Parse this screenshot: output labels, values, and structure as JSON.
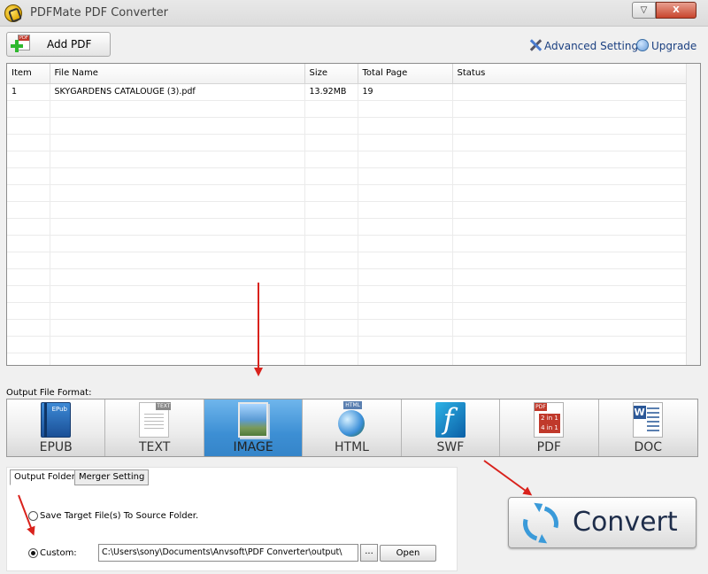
{
  "window": {
    "title": "PDFMate PDF Converter",
    "min_glyph": "▽",
    "close_glyph": "X"
  },
  "toolbar": {
    "add_pdf_label": "Add PDF",
    "advanced_settings_label": "Advanced Settings",
    "upgrade_label": "Upgrade"
  },
  "file_table": {
    "columns": [
      "Item",
      "File Name",
      "Size",
      "Total Page",
      "Status"
    ],
    "rows": [
      {
        "item": "1",
        "file_name": "SKYGARDENS CATALOUGE (3).pdf",
        "size": "13.92MB",
        "total_page": "19",
        "status": ""
      }
    ]
  },
  "output_format": {
    "label": "Output File Format:",
    "selected": "IMAGE",
    "formats": [
      {
        "label": "EPUB",
        "icon": "epub-icon"
      },
      {
        "label": "TEXT",
        "icon": "text-icon"
      },
      {
        "label": "IMAGE",
        "icon": "image-icon"
      },
      {
        "label": "HTML",
        "icon": "html-icon"
      },
      {
        "label": "SWF",
        "icon": "swf-icon"
      },
      {
        "label": "PDF",
        "icon": "pdf-icon"
      },
      {
        "label": "DOC",
        "icon": "doc-icon"
      }
    ]
  },
  "settings_tabs": {
    "output_folder_tab": "Output Folder",
    "merger_setting_tab": "Merger Setting",
    "save_to_source_label": "Save Target File(s) To Source Folder.",
    "custom_label": "Custom:",
    "custom_path": "C:\\Users\\sony\\Documents\\Anvsoft\\PDF Converter\\output\\",
    "browse_label": "...",
    "open_label": "Open"
  },
  "convert": {
    "label": "Convert"
  },
  "colors": {
    "accent_selected": "#3d8fd4",
    "annotation_arrow": "#d9221c",
    "link": "#1a3f80"
  }
}
